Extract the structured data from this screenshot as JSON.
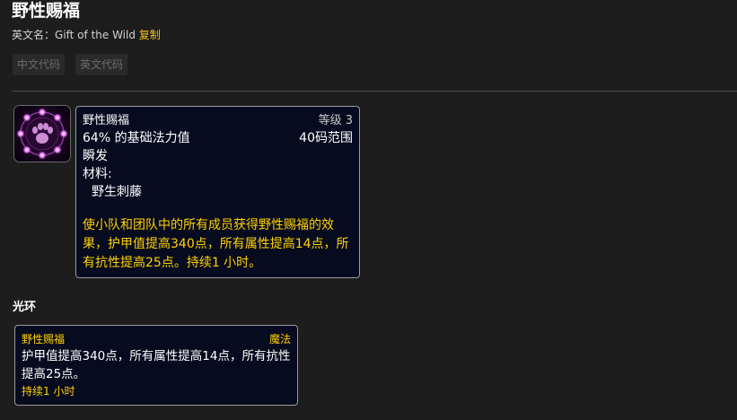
{
  "page": {
    "title": "野性赐福",
    "english_name_label": "英文名：",
    "english_name": "Gift of the Wild",
    "copy_label": "复制",
    "code_buttons": [
      "中文代码",
      "英文代码"
    ]
  },
  "spell_tooltip": {
    "name": "野性赐福",
    "level": "等级 3",
    "cost": "64% 的基础法力值",
    "range": "40码范围",
    "cast": "瞬发",
    "reagents_label": "材料:",
    "reagent": "野生刺藤",
    "description": "使小队和团队中的所有成员获得野性赐福的效果，护甲值提高340点，所有属性提高14点，所有抗性提高25点。持续1 小时。"
  },
  "aura": {
    "section_title": "光环",
    "name": "野性赐福",
    "school": "魔法",
    "effect": "护甲值提高340点，所有属性提高14点，所有抗性提高25点。",
    "duration": "持续1 小时"
  },
  "icon": {
    "name": "gift-of-the-wild-paw-icon",
    "glow_color": "#d64ee6"
  }
}
